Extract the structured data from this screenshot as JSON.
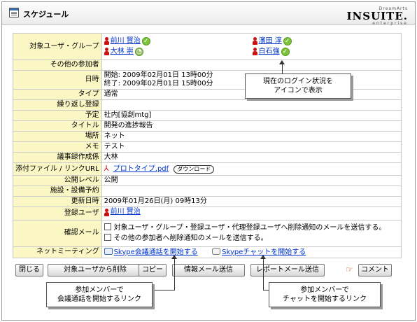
{
  "header": {
    "title": "スケジュール",
    "logo_top": "DreamArts",
    "logo_main": "INSUITE.",
    "logo_sub": "enterprise"
  },
  "rows": {
    "target": {
      "label": "対象ユーザ・グループ",
      "users": [
        "前川 賢治",
        "大林 崇",
        "濱田 淳",
        "白石強"
      ]
    },
    "other": {
      "label": "その他の参加者",
      "value": ""
    },
    "datetime": {
      "label": "日時",
      "start": "開始: 2009年02月01日 13時00分",
      "end": "終了: 2009年02月01日 15時00分"
    },
    "type": {
      "label": "タイプ",
      "value": "通常"
    },
    "repeat": {
      "label": "繰り返し登録",
      "value": ""
    },
    "plan": {
      "label": "予定",
      "value": "社内[協創mtg]"
    },
    "title": {
      "label": "タイトル",
      "value": "開発の進捗報告"
    },
    "place": {
      "label": "場所",
      "value": "ネット"
    },
    "memo": {
      "label": "メモ",
      "value": "テスト"
    },
    "minutes": {
      "label": "議事録作成係",
      "value": "大林"
    },
    "attach": {
      "label": "添付ファイル / リンクURL",
      "file": "プロトタイプ.pdf",
      "download": "ダウンロード"
    },
    "public": {
      "label": "公開レベル",
      "value": "公開"
    },
    "facility": {
      "label": "施設・設備予約",
      "value": ""
    },
    "updated": {
      "label": "更新日時",
      "value": "2009年01月26日(月) 09時13分"
    },
    "registrant": {
      "label": "登録ユーザ",
      "value": "前川 賢治"
    },
    "mail": {
      "label": "確認メール",
      "opt1": "対象ユーザ・グループ・登録ユーザ・代理登録ユーザへ削除通知のメールを送信する。",
      "opt2": "その他の参加者へ削除通知のメールを送信する。"
    },
    "meeting": {
      "label": "ネットミーティング",
      "call_link": "Skype会議通話を開始する",
      "chat_link": "Skypeチャットを開始する"
    }
  },
  "buttons": {
    "close": "閉じる",
    "remove": "対象ユーザから削除",
    "copy": "コピー",
    "info_mail": "情報メール送信",
    "report_mail": "レポートメール送信",
    "comment": "コメント"
  },
  "callouts": {
    "login_line1": "現在のログイン状況を",
    "login_line2": "アイコンで表示",
    "call_line1": "参加メンバーで",
    "call_line2": "会議通話を開始するリンク",
    "chat_line1": "参加メンバーで",
    "chat_line2": "チャットを開始するリンク"
  }
}
